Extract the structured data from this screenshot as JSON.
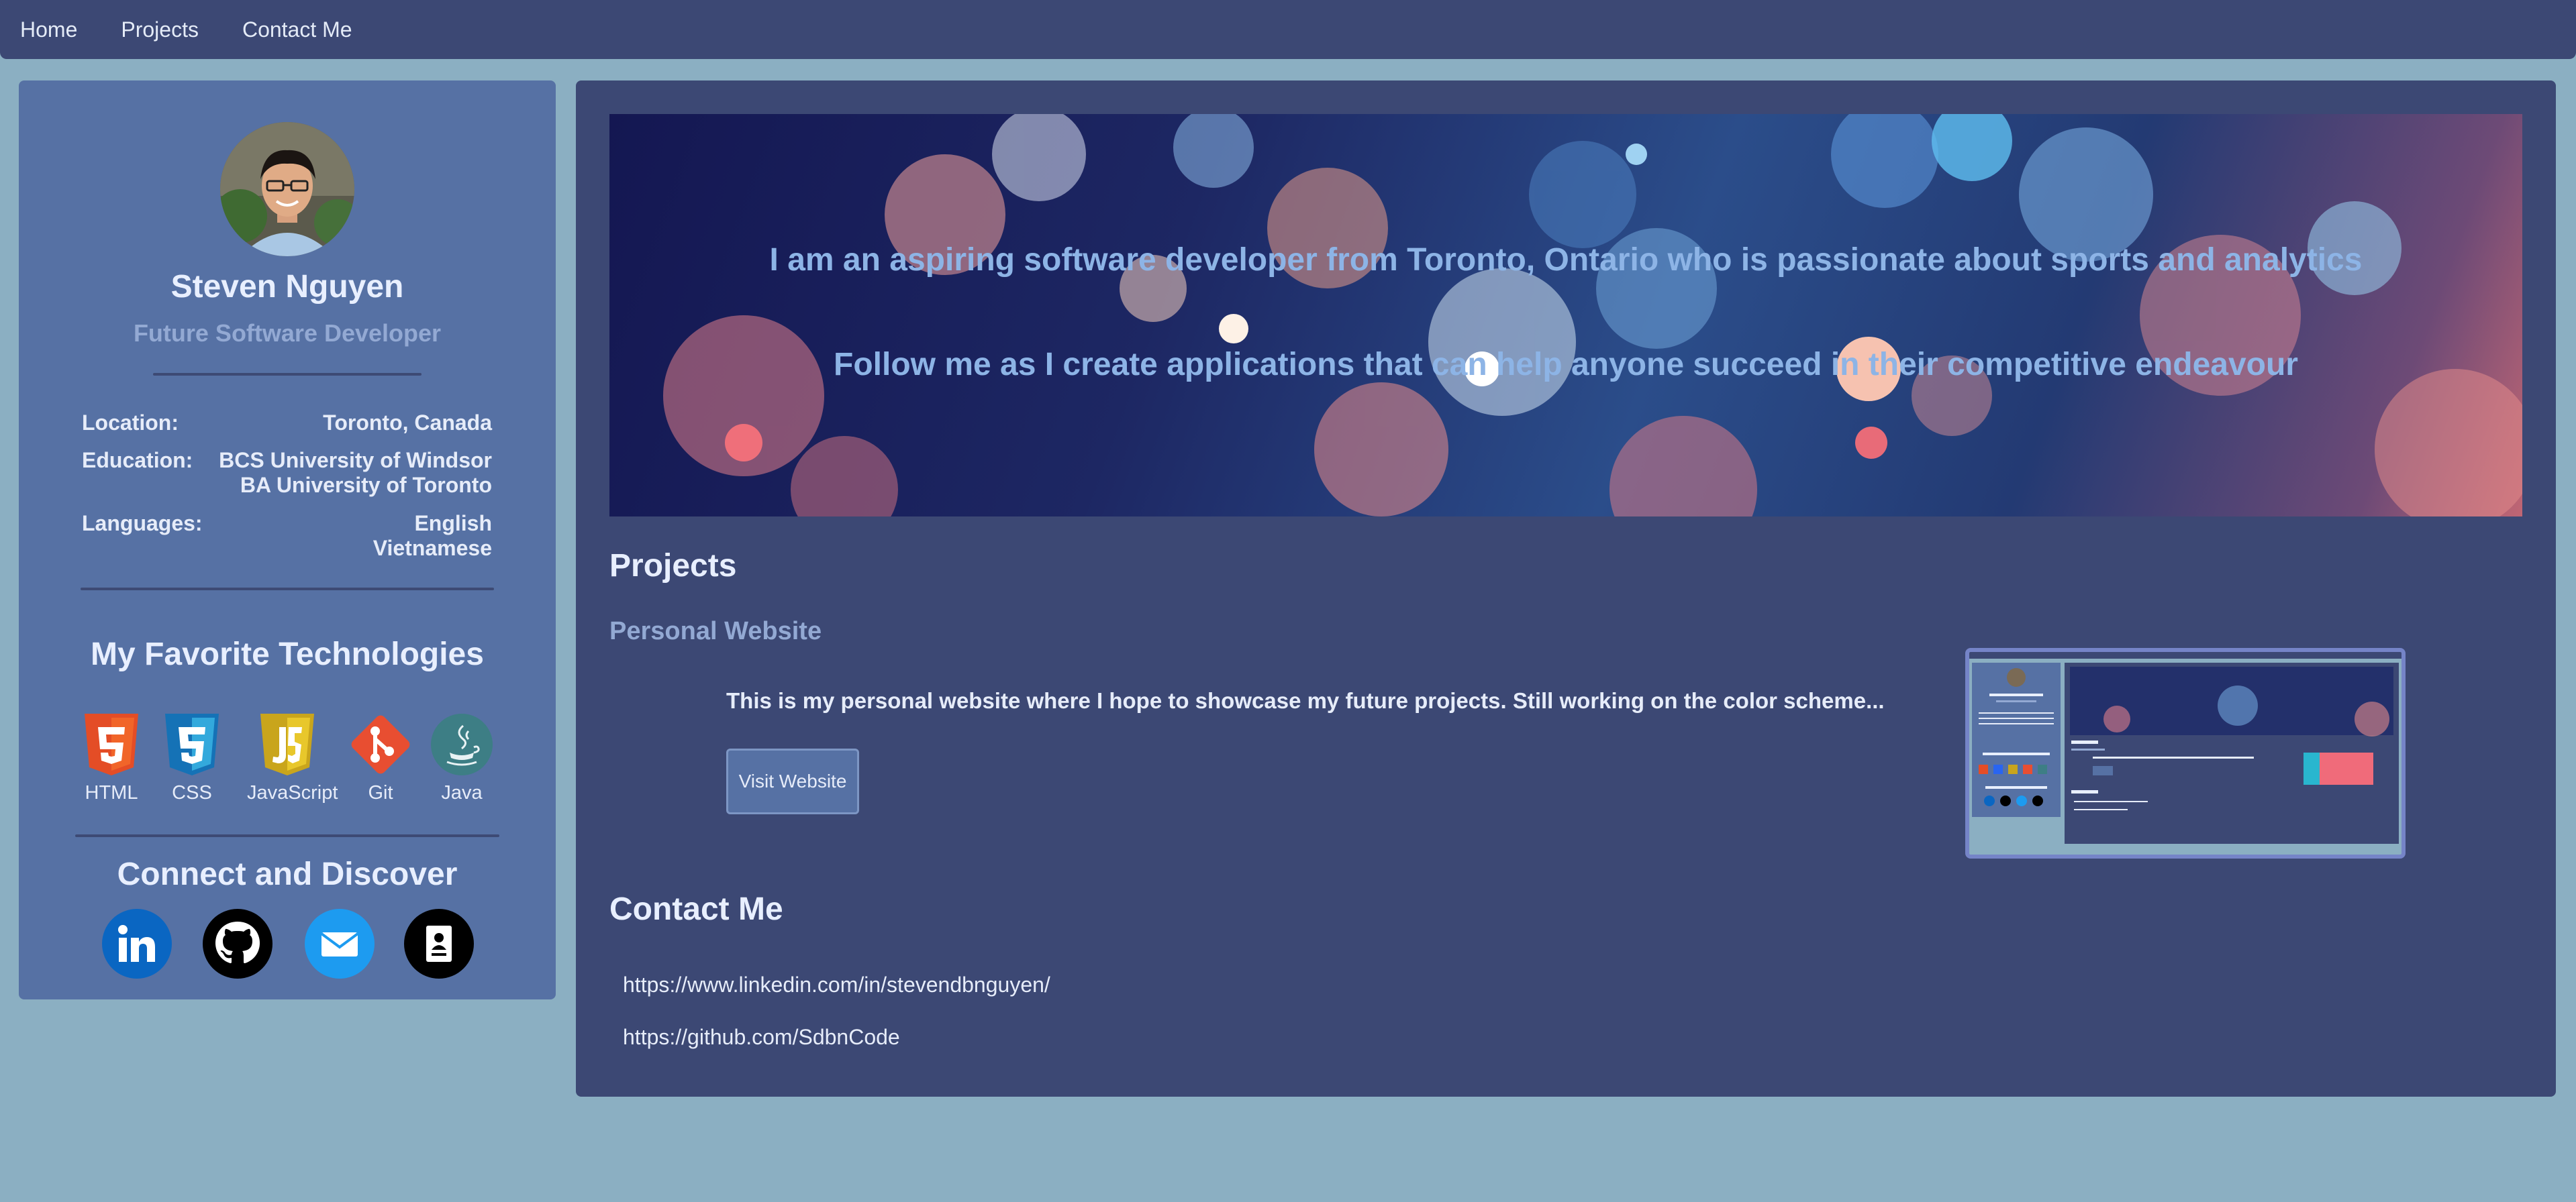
{
  "nav": {
    "items": [
      "Home",
      "Projects",
      "Contact Me"
    ]
  },
  "profile": {
    "name": "Steven Nguyen",
    "role": "Future Software Developer",
    "info": {
      "location_label": "Location:",
      "location_value": "Toronto, Canada",
      "education_label": "Education:",
      "education_values": [
        "BCS University of Windsor",
        "BA University of Toronto"
      ],
      "languages_label": "Languages:",
      "languages_values": [
        "English",
        "Vietnamese"
      ]
    }
  },
  "technologies": {
    "heading": "My Favorite Technologies",
    "items": [
      {
        "label": "HTML",
        "icon": "html5-icon",
        "color": "#e44d26"
      },
      {
        "label": "CSS",
        "icon": "css3-icon",
        "color": "#2965f1"
      },
      {
        "label": "JavaScript",
        "icon": "javascript-icon",
        "color": "#c9a51c"
      },
      {
        "label": "Git",
        "icon": "git-icon",
        "color": "#e84e31"
      },
      {
        "label": "Java",
        "icon": "java-icon",
        "color": "#3d7e85"
      }
    ]
  },
  "connect": {
    "heading": "Connect and Discover",
    "items": [
      {
        "icon": "linkedin-icon",
        "color": "#0a66c2"
      },
      {
        "icon": "github-icon",
        "color": "#000000"
      },
      {
        "icon": "email-icon",
        "color": "#1d9bf0"
      },
      {
        "icon": "resume-icon",
        "color": "#000000"
      }
    ]
  },
  "hero": {
    "line1": "I am an aspiring software developer from Toronto, Ontario who is passionate about sports and analytics",
    "line2": "Follow me as I create applications that can help anyone succeed in their competitive endeavour"
  },
  "projects": {
    "heading": "Projects",
    "items": [
      {
        "title": "Personal Website",
        "description": "This is my personal website where I hope to showcase my future projects. Still working on the color scheme...",
        "button_label": "Visit Website"
      }
    ]
  },
  "contact": {
    "heading": "Contact Me",
    "links": [
      "https://www.linkedin.com/in/stevendbnguyen/",
      "https://github.com/SdbnCode"
    ]
  },
  "colors": {
    "page_bg": "#8bafc2",
    "nav_bg": "#3c4874",
    "sidebar_bg": "#5671a4",
    "main_bg": "#3c4874",
    "accent_text": "#93a9d3"
  }
}
